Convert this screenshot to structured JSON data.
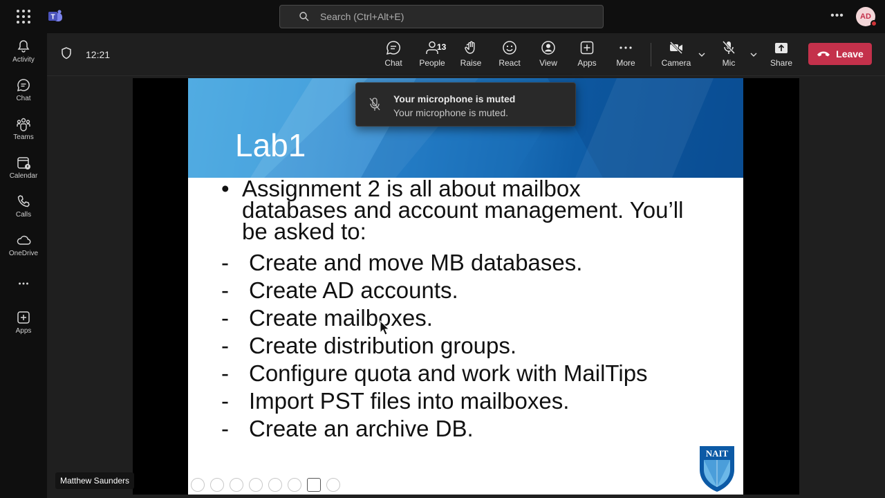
{
  "search": {
    "placeholder": "Search (Ctrl+Alt+E)"
  },
  "user": {
    "initials": "AD"
  },
  "rail": {
    "items": [
      {
        "label": "Activity",
        "icon": "bell-icon"
      },
      {
        "label": "Chat",
        "icon": "chat-icon"
      },
      {
        "label": "Teams",
        "icon": "teams-icon"
      },
      {
        "label": "Calendar",
        "icon": "calendar-icon"
      },
      {
        "label": "Calls",
        "icon": "phone-icon"
      },
      {
        "label": "OneDrive",
        "icon": "cloud-icon"
      },
      {
        "label": "Apps",
        "icon": "plus-square-icon"
      }
    ]
  },
  "meeting": {
    "timer": "12:21",
    "people_count": "13",
    "controls": {
      "chat": "Chat",
      "people": "People",
      "raise": "Raise",
      "react": "React",
      "view": "View",
      "apps": "Apps",
      "more": "More",
      "camera": "Camera",
      "mic": "Mic",
      "share": "Share"
    },
    "leave_label": "Leave",
    "presenter": "Matthew Saunders"
  },
  "toast": {
    "title": "Your microphone is muted",
    "message": "Your microphone is muted."
  },
  "slide": {
    "title": "Lab1",
    "bullet_mark": "•",
    "bullet": "Assignment 2 is all about mailbox databases and account management. You’ll be asked to:",
    "dash": "-",
    "items": [
      "Create and move MB databases.",
      "Create AD accounts.",
      "Create mailboxes.",
      "Create distribution groups.",
      "Configure quota and work with MailTips",
      "Import PST files into mailboxes.",
      "Create an archive DB."
    ],
    "logo_text": "NAIT"
  },
  "colors": {
    "leave": "#c4314b",
    "accent": "#2b86cf"
  }
}
